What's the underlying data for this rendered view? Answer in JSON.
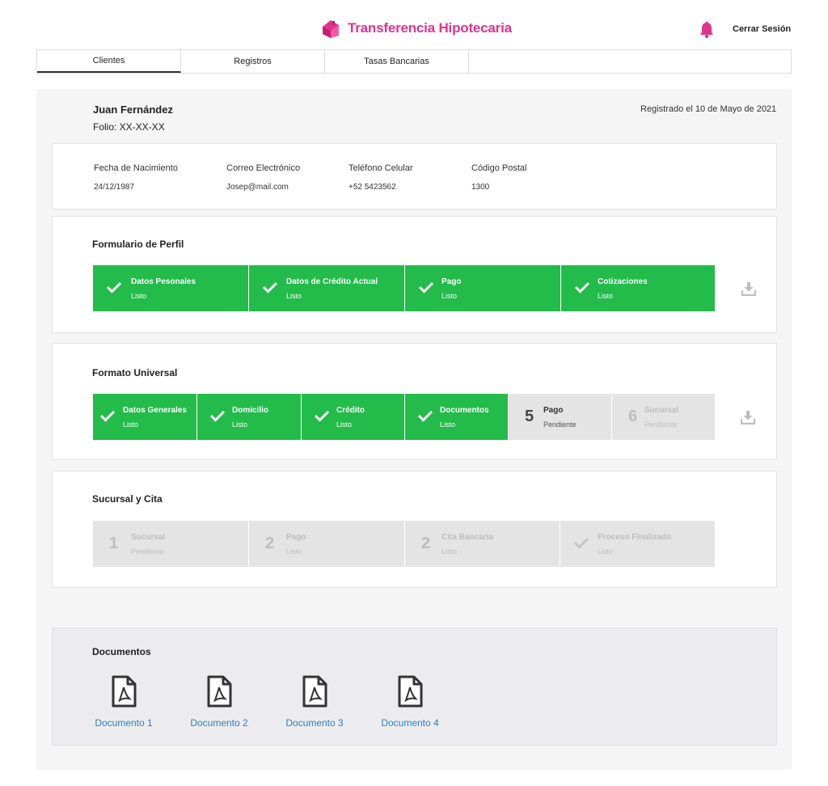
{
  "app": {
    "title": "Transferencia Hipotecaria",
    "logout_label": "Cerrar Sesión",
    "brand_color": "#e0338e",
    "logo_icon": "house-icon",
    "bell_icon": "bell-icon"
  },
  "tabs": [
    {
      "label": "Clientes",
      "active": true
    },
    {
      "label": "Registros",
      "active": false
    },
    {
      "label": "Tasas Bancarias",
      "active": false
    }
  ],
  "client": {
    "name": "Juan Fernández",
    "folio": "Folio: XX-XX-XX",
    "registered": "Registrado el 10 de Mayo de 2021"
  },
  "info": [
    {
      "label": "Fecha de Nacimiento",
      "value": "24/12/1987"
    },
    {
      "label": "Correo Electrónico",
      "value": "Josep@mail.com"
    },
    {
      "label": "Teléfono Celular",
      "value": "+52 5423562"
    },
    {
      "label": "Código Postal",
      "value": "1300"
    }
  ],
  "perfil": {
    "title": "Formulario de Perfil",
    "steps": [
      {
        "title": "Datos Pesonales",
        "status": "Listo",
        "state": "done"
      },
      {
        "title": "Datos de Crédito Actual",
        "status": "Listo",
        "state": "done"
      },
      {
        "title": "Pago",
        "status": "Listo",
        "state": "done"
      },
      {
        "title": "Cotizaciones",
        "status": "Listo",
        "state": "done"
      }
    ]
  },
  "universal": {
    "title": "Formato Universal",
    "steps": [
      {
        "title": "Datos Generales",
        "status": "Listo",
        "state": "done"
      },
      {
        "title": "Domicilio",
        "status": "Listo",
        "state": "done"
      },
      {
        "title": "Crédito",
        "status": "Listo",
        "state": "done"
      },
      {
        "title": "Documentos",
        "status": "Listo",
        "state": "done"
      },
      {
        "number": "5",
        "title": "Pago",
        "status": "Pendiente",
        "state": "pending"
      },
      {
        "number": "6",
        "title": "Sucursal",
        "status": "Pendiente",
        "state": "muted"
      }
    ]
  },
  "cita": {
    "title": "Sucursal y Cita",
    "steps": [
      {
        "number": "1",
        "title": "Sucursal",
        "status": "Pendiente",
        "state": "muted"
      },
      {
        "number": "2",
        "title": "Pago",
        "status": "Listo",
        "state": "muted"
      },
      {
        "number": "2",
        "title": "Cita Bancaria",
        "status": "Listo",
        "state": "muted"
      },
      {
        "title": "Proceso Finalizado",
        "status": "Listo",
        "state": "muted"
      }
    ]
  },
  "documents": {
    "title": "Documentos",
    "items": [
      "Documento 1",
      "Documento 2",
      "Documento 3",
      "Documento 4"
    ]
  },
  "colors": {
    "done": "#23bb4a",
    "pending": "#e4e4e4",
    "link": "#2d7fc1"
  }
}
